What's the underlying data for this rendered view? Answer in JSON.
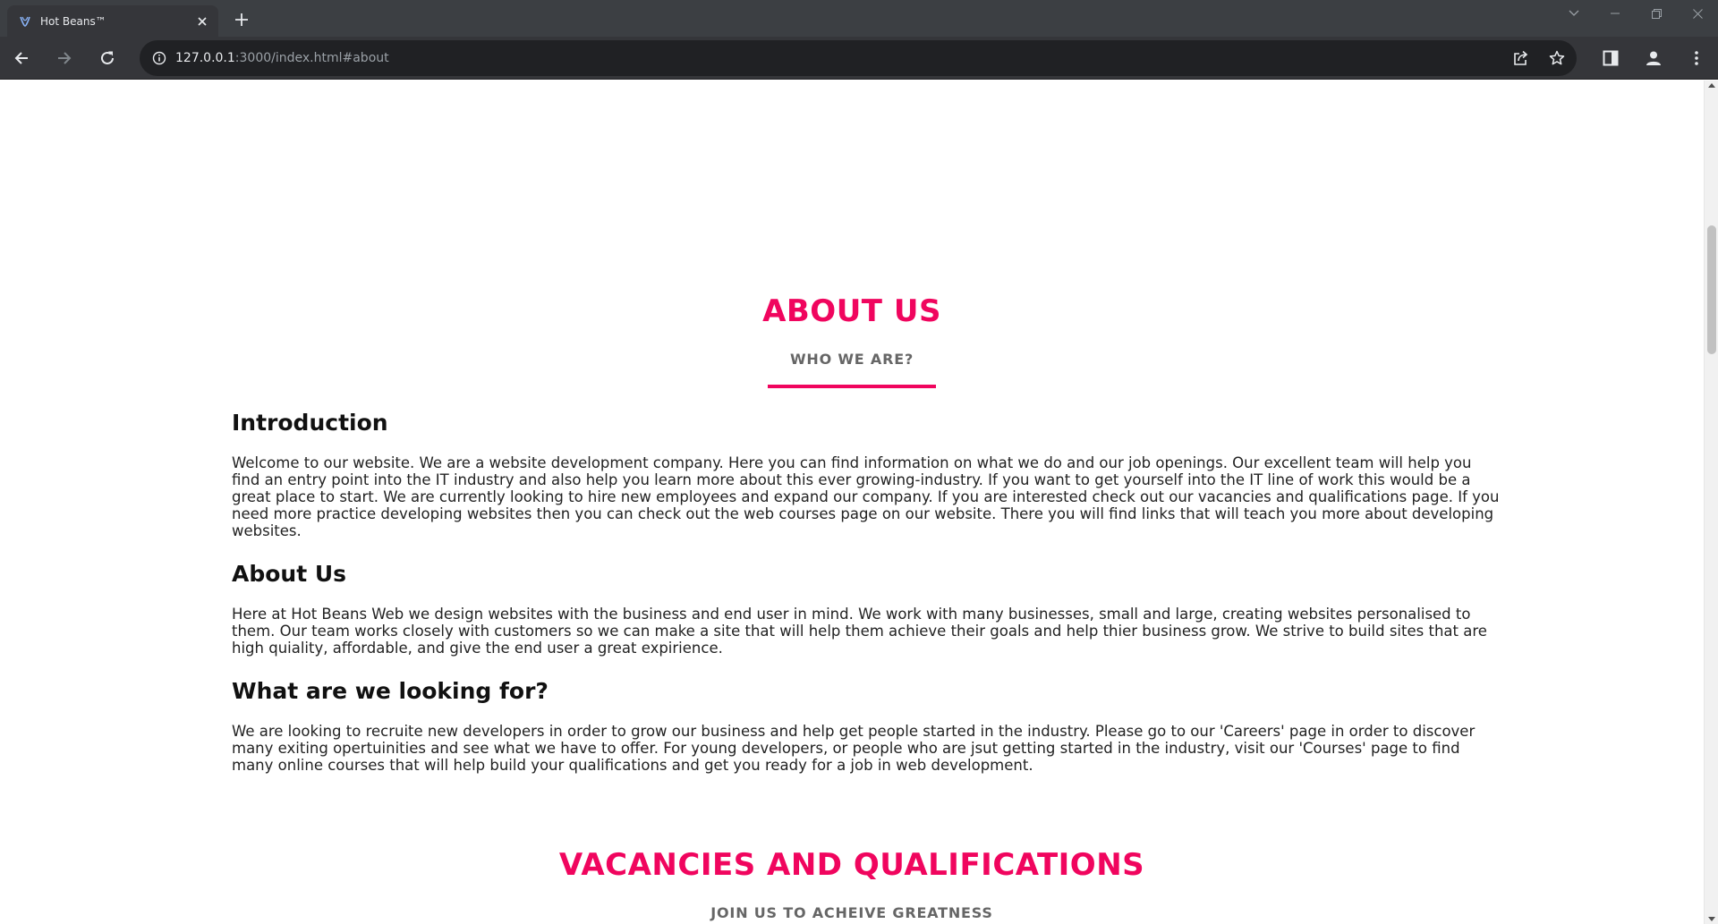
{
  "browser": {
    "tab_title": "Hot Beans™",
    "url_host": "127.0.0.1",
    "url_rest": ":3000/index.html#about"
  },
  "icons": [
    "favicon-icon",
    "close-icon",
    "plus-icon",
    "chevron-down-icon",
    "minimize-icon",
    "restore-icon",
    "window-close-icon",
    "back-arrow-icon",
    "forward-arrow-icon",
    "reload-icon",
    "info-icon",
    "share-icon",
    "star-icon",
    "side-panel-icon",
    "profile-icon",
    "kebab-menu-icon"
  ],
  "colors": {
    "accent": "#f0055e",
    "subtitle": "#666666",
    "chrome_dark": "#35363a"
  },
  "about": {
    "title": "ABOUT US",
    "subtitle": "WHO WE ARE?",
    "sections": [
      {
        "heading": "Introduction",
        "body": "Welcome to our website. We are a website development company. Here you can find information on what we do and our job openings. Our excellent team will help you find an entry point into the IT industry and also help you learn more about this ever growing-industry. If you want to get yourself into the IT line of work this would be a great place to start. We are currently looking to hire new employees and expand our company. If you are interested check out our vacancies and qualifications page. If you need more practice developing websites then you can check out the web courses page on our website. There you will find links that will teach you more about developing websites."
      },
      {
        "heading": "About Us",
        "body": "Here at Hot Beans Web we design websites with the business and end user in mind. We work with many businesses, small and large, creating websites personalised to them. Our team works closely with customers so we can make a site that will help them achieve their goals and help thier business grow. We strive to build sites that are high quiality, affordable, and give the end user a great expirience."
      },
      {
        "heading": "What are we looking for?",
        "body": "We are looking to recruite new developers in order to grow our business and help get people started in the industry. Please go to our 'Careers' page in order to discover many exiting opertuinities and see what we have to offer. For young developers, or people who are jsut getting started in the industry, visit our 'Courses' page to find many online courses that will help build your qualifications and get you ready for a job in web development."
      }
    ]
  },
  "vacancies": {
    "title": "VACANCIES AND QUALIFICATIONS",
    "subtitle": "JOIN US TO ACHEIVE GREATNESS"
  }
}
